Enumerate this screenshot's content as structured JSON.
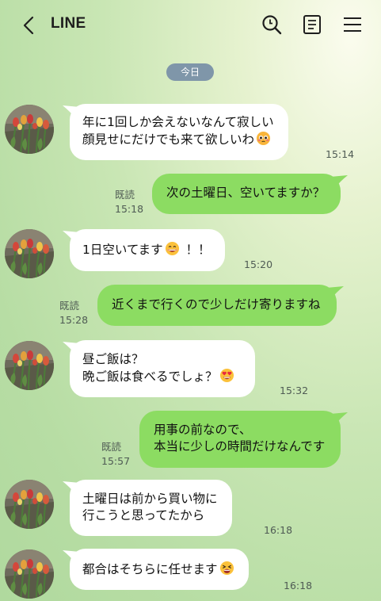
{
  "header": {
    "title": "LINE"
  },
  "date_label": "今日",
  "icons": {
    "back": "chevron-left-icon",
    "search": "search-icon",
    "notes": "notes-icon",
    "menu": "hamburger-menu-icon"
  },
  "colors": {
    "sent_bubble": "#8cdc62",
    "received_bubble": "#ffffff",
    "date_pill": "#7f96a9"
  },
  "messages": [
    {
      "dir": "received",
      "lines": [
        "年に1回しか会えないなんて寂しい",
        "顔見せにだけでも来て欲しいわ"
      ],
      "emoji": "pleading-face",
      "time": "15:14"
    },
    {
      "dir": "sent",
      "lines": [
        "次の土曜日、空いてますか？"
      ],
      "read": "既読",
      "time": "15:18"
    },
    {
      "dir": "received",
      "lines": [
        "1日空いてます",
        "！！"
      ],
      "emoji": "grinning-face",
      "time": "15:20"
    },
    {
      "dir": "sent",
      "lines": [
        "近くまで行くので少しだけ寄りますね"
      ],
      "read": "既読",
      "time": "15:28"
    },
    {
      "dir": "received",
      "lines": [
        "昼ご飯は？",
        "晩ご飯は食べるでしょ？"
      ],
      "emoji": "heart-eyes-face",
      "time": "15:32"
    },
    {
      "dir": "sent",
      "lines": [
        "用事の前なので、",
        "本当に少しの時間だけなんです"
      ],
      "read": "既読",
      "time": "15:57"
    },
    {
      "dir": "received",
      "lines": [
        "土曜日は前から買い物に",
        "行こうと思ってたから"
      ],
      "time": "16:18"
    },
    {
      "dir": "received",
      "lines": [
        "都合はそちらに任せます"
      ],
      "emoji": "tired-face",
      "time": "16:18"
    }
  ]
}
